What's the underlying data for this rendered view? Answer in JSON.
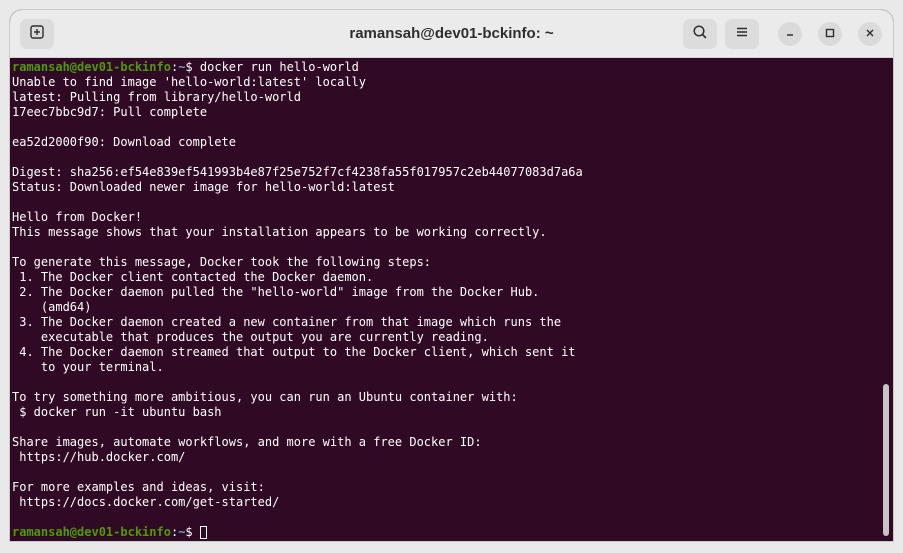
{
  "window": {
    "title": "ramansah@dev01-bckinfo: ~"
  },
  "toolbar": {
    "new_tab_icon": "new-tab-icon",
    "search_icon": "search-icon",
    "menu_icon": "hamburger-menu-icon",
    "minimize_icon": "minimize-icon",
    "maximize_icon": "maximize-icon",
    "close_icon": "close-icon"
  },
  "prompt": {
    "user_host": "ramansah@dev01-bckinfo",
    "path": "~",
    "symbol": "$"
  },
  "command": "docker run hello-world",
  "output": [
    "Unable to find image 'hello-world:latest' locally",
    "latest: Pulling from library/hello-world",
    "17eec7bbc9d7: Pull complete",
    "",
    "ea52d2000f90: Download complete",
    "",
    "Digest: sha256:ef54e839ef541993b4e87f25e752f7cf4238fa55f017957c2eb44077083d7a6a",
    "Status: Downloaded newer image for hello-world:latest",
    "",
    "Hello from Docker!",
    "This message shows that your installation appears to be working correctly.",
    "",
    "To generate this message, Docker took the following steps:",
    " 1. The Docker client contacted the Docker daemon.",
    " 2. The Docker daemon pulled the \"hello-world\" image from the Docker Hub.",
    "    (amd64)",
    " 3. The Docker daemon created a new container from that image which runs the",
    "    executable that produces the output you are currently reading.",
    " 4. The Docker daemon streamed that output to the Docker client, which sent it",
    "    to your terminal.",
    "",
    "To try something more ambitious, you can run an Ubuntu container with:",
    " $ docker run -it ubuntu bash",
    "",
    "Share images, automate workflows, and more with a free Docker ID:",
    " https://hub.docker.com/",
    "",
    "For more examples and ideas, visit:",
    " https://docs.docker.com/get-started/",
    ""
  ],
  "colors": {
    "terminal_bg": "#300a24",
    "prompt_user": "#4e9a06",
    "prompt_path": "#729fcf",
    "text": "#ffffff"
  }
}
